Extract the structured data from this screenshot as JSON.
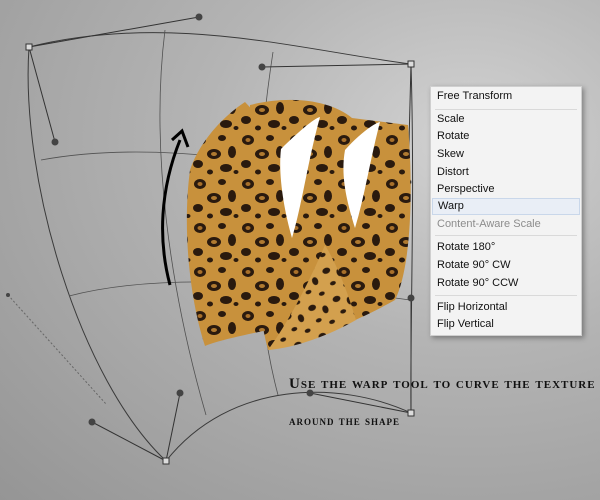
{
  "menu": {
    "items": [
      {
        "label": "Free Transform",
        "state": "normal"
      },
      {
        "label": "Scale",
        "state": "normal"
      },
      {
        "label": "Rotate",
        "state": "normal"
      },
      {
        "label": "Skew",
        "state": "normal"
      },
      {
        "label": "Distort",
        "state": "normal"
      },
      {
        "label": "Perspective",
        "state": "normal"
      },
      {
        "label": "Warp",
        "state": "highlighted"
      },
      {
        "label": "Content-Aware Scale",
        "state": "disabled"
      },
      {
        "label": "Rotate 180°",
        "state": "normal"
      },
      {
        "label": "Rotate 90° CW",
        "state": "normal"
      },
      {
        "label": "Rotate 90° CCW",
        "state": "normal"
      },
      {
        "label": "Flip Horizontal",
        "state": "normal"
      },
      {
        "label": "Flip Vertical",
        "state": "normal"
      }
    ]
  },
  "caption": {
    "line1": "Use the warp tool to curve the texture",
    "line2": "around the shape"
  },
  "colors": {
    "menu_background": "#f3f3f3",
    "highlight": "#e9eef6",
    "disabled_text": "#8c8c8c",
    "texture_base": "#c8913c",
    "texture_spots": "#2a1a0e",
    "warp_grid": "#444444"
  },
  "icons": [
    "curved-arrow-icon",
    "leopard-texture-image"
  ]
}
